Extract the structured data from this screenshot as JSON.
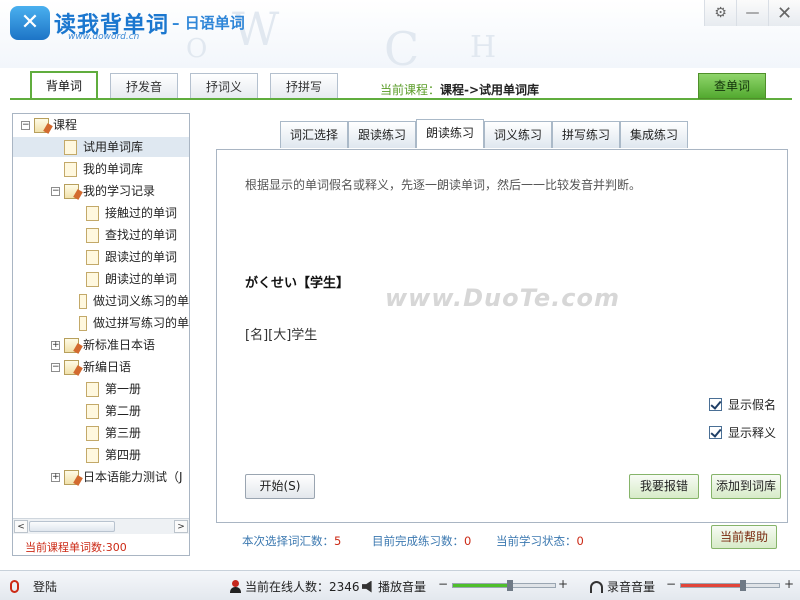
{
  "header": {
    "logo_mark": "✕",
    "logo_title": "读我背单词",
    "logo_subtitle": "– 日语单词",
    "logo_url": "www.doword.cn",
    "window_buttons": [
      "⚙",
      "—",
      "✕"
    ]
  },
  "main_tabs": [
    {
      "label": "背单词",
      "active": true
    },
    {
      "label": "抒发音",
      "active": false
    },
    {
      "label": "抒词义",
      "active": false
    },
    {
      "label": "抒拼写",
      "active": false
    }
  ],
  "current_course": {
    "prefix": "当前课程：",
    "value": "课程->试用单词库"
  },
  "lookup_button": "查单词",
  "tree": {
    "items": [
      {
        "label": "课程",
        "level": 0,
        "expander": "−",
        "icon": "folder",
        "selected": false
      },
      {
        "label": "试用单词库",
        "level": 1,
        "expander": "",
        "icon": "page",
        "selected": true
      },
      {
        "label": "我的单词库",
        "level": 1,
        "expander": "",
        "icon": "page",
        "selected": false
      },
      {
        "label": "我的学习记录",
        "level": 1,
        "expander": "−",
        "icon": "folder",
        "selected": false
      },
      {
        "label": "接触过的单词",
        "level": 2,
        "expander": "",
        "icon": "page",
        "selected": false
      },
      {
        "label": "查找过的单词",
        "level": 2,
        "expander": "",
        "icon": "page",
        "selected": false
      },
      {
        "label": "跟读过的单词",
        "level": 2,
        "expander": "",
        "icon": "page",
        "selected": false
      },
      {
        "label": "朗读过的单词",
        "level": 2,
        "expander": "",
        "icon": "page",
        "selected": false
      },
      {
        "label": "做过词义练习的单",
        "level": 2,
        "expander": "",
        "icon": "page",
        "selected": false
      },
      {
        "label": "做过拼写练习的单",
        "level": 2,
        "expander": "",
        "icon": "page",
        "selected": false
      },
      {
        "label": "新标准日本语",
        "level": 1,
        "expander": "+",
        "icon": "folder",
        "selected": false
      },
      {
        "label": "新编日语",
        "level": 1,
        "expander": "−",
        "icon": "folder",
        "selected": false
      },
      {
        "label": "第一册",
        "level": 2,
        "expander": "",
        "icon": "page",
        "selected": false
      },
      {
        "label": "第二册",
        "level": 2,
        "expander": "",
        "icon": "page",
        "selected": false
      },
      {
        "label": "第三册",
        "level": 2,
        "expander": "",
        "icon": "page",
        "selected": false
      },
      {
        "label": "第四册",
        "level": 2,
        "expander": "",
        "icon": "page",
        "selected": false
      },
      {
        "label": "日本语能力测试（J",
        "level": 1,
        "expander": "+",
        "icon": "folder",
        "selected": false
      }
    ],
    "scroll_left": "<",
    "scroll_right": ">",
    "course_word_count_label": "当前课程单词数:300"
  },
  "sub_tabs": [
    {
      "label": "词汇选择",
      "active": false
    },
    {
      "label": "跟读练习",
      "active": false
    },
    {
      "label": "朗读练习",
      "active": true
    },
    {
      "label": "词义练习",
      "active": false
    },
    {
      "label": "拼写练习",
      "active": false
    },
    {
      "label": "集成练习",
      "active": false
    }
  ],
  "practice": {
    "instruction": "根据显示的单词假名或释义，先逐一朗读单词，然后一一比较发音并判断。",
    "word_kana": "がくせい【学生】",
    "watermark": "www.DuoTe.com",
    "word_meaning": "[名][大]学生",
    "show_kana_label": "显示假名",
    "show_meaning_label": "显示释义",
    "show_kana_checked": true,
    "show_meaning_checked": true,
    "start_button": "开始(S)",
    "report_error_button": "我要报错",
    "add_to_library_button": "添加到词库"
  },
  "status": {
    "selected_words_label": "本次选择词汇数：",
    "selected_words_value": "5",
    "completed_label": "目前完成练习数：",
    "completed_value": "0",
    "learning_state_label": "当前学习状态：",
    "learning_state_value": "0",
    "help_button": "当前帮助"
  },
  "footer": {
    "login_label": "登陆",
    "online_label": "当前在线人数：2346",
    "playback_volume_label": "播放音量",
    "record_volume_label": "录音音量",
    "minus": "−",
    "plus": "+",
    "playback_volume": 0.55,
    "record_volume": 0.62
  },
  "colors": {
    "accent_green": "#60ad3e",
    "brand_blue": "#1b77cf",
    "alert_red": "#cc2a16"
  }
}
